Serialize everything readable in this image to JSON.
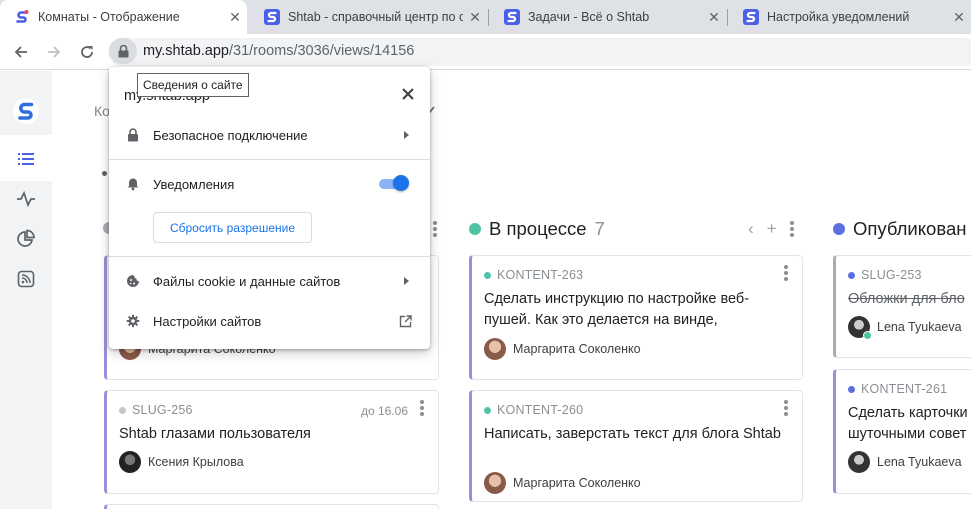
{
  "browser": {
    "tabs": [
      {
        "title": "Комнаты - Отображение",
        "active": true
      },
      {
        "title": "Shtab - справочный центр по с",
        "active": false
      },
      {
        "title": "Задачи - Всё о Shtab",
        "active": false
      },
      {
        "title": "Настройка уведомлений",
        "active": false
      }
    ],
    "url_host": "my.shtab.app",
    "url_path": "/31/rooms/3036/views/14156",
    "tooltip": "Сведения о сайте"
  },
  "site_info": {
    "host": "my.shtab.app",
    "secure_label": "Безопасное подключение",
    "notifications_label": "Уведомления",
    "notifications_enabled": true,
    "reset_label": "Сбросить разрешение",
    "cookies_label": "Файлы cookie и данные сайтов",
    "site_settings_label": "Настройки сайтов"
  },
  "app": {
    "breadcrumb_start": "Ко",
    "columns": [
      {
        "title": "В процессе",
        "count": "7",
        "color": "#4ec3a6",
        "cards": [
          {
            "tag": "KONTENT-263",
            "title": "Сделать инструкцию по настройке веб-пушей. Как это делается на винде,",
            "user": "Маргарита Соколенко"
          },
          {
            "tag": "KONTENT-260",
            "title": "Написать, заверстать текст для блога Shtab",
            "user": "Маргарита Соколенко"
          }
        ]
      },
      {
        "title": "Опубликован",
        "color": "#5b6fe0",
        "cards": [
          {
            "tag": "SLUG-253",
            "title": "Обложки для бло",
            "user": "Lena Tyukaeva"
          },
          {
            "tag": "KONTENT-261",
            "title": "Сделать карточки шуточными совет",
            "user": "Lena Tyukaeva"
          }
        ]
      }
    ],
    "left_cards": [
      {
        "user": "Маргарита Соколенко"
      },
      {
        "tag": "SLUG-256",
        "due": "до 16.06",
        "title": "Shtab глазами пользователя",
        "user": "Ксения Крылова"
      }
    ]
  }
}
